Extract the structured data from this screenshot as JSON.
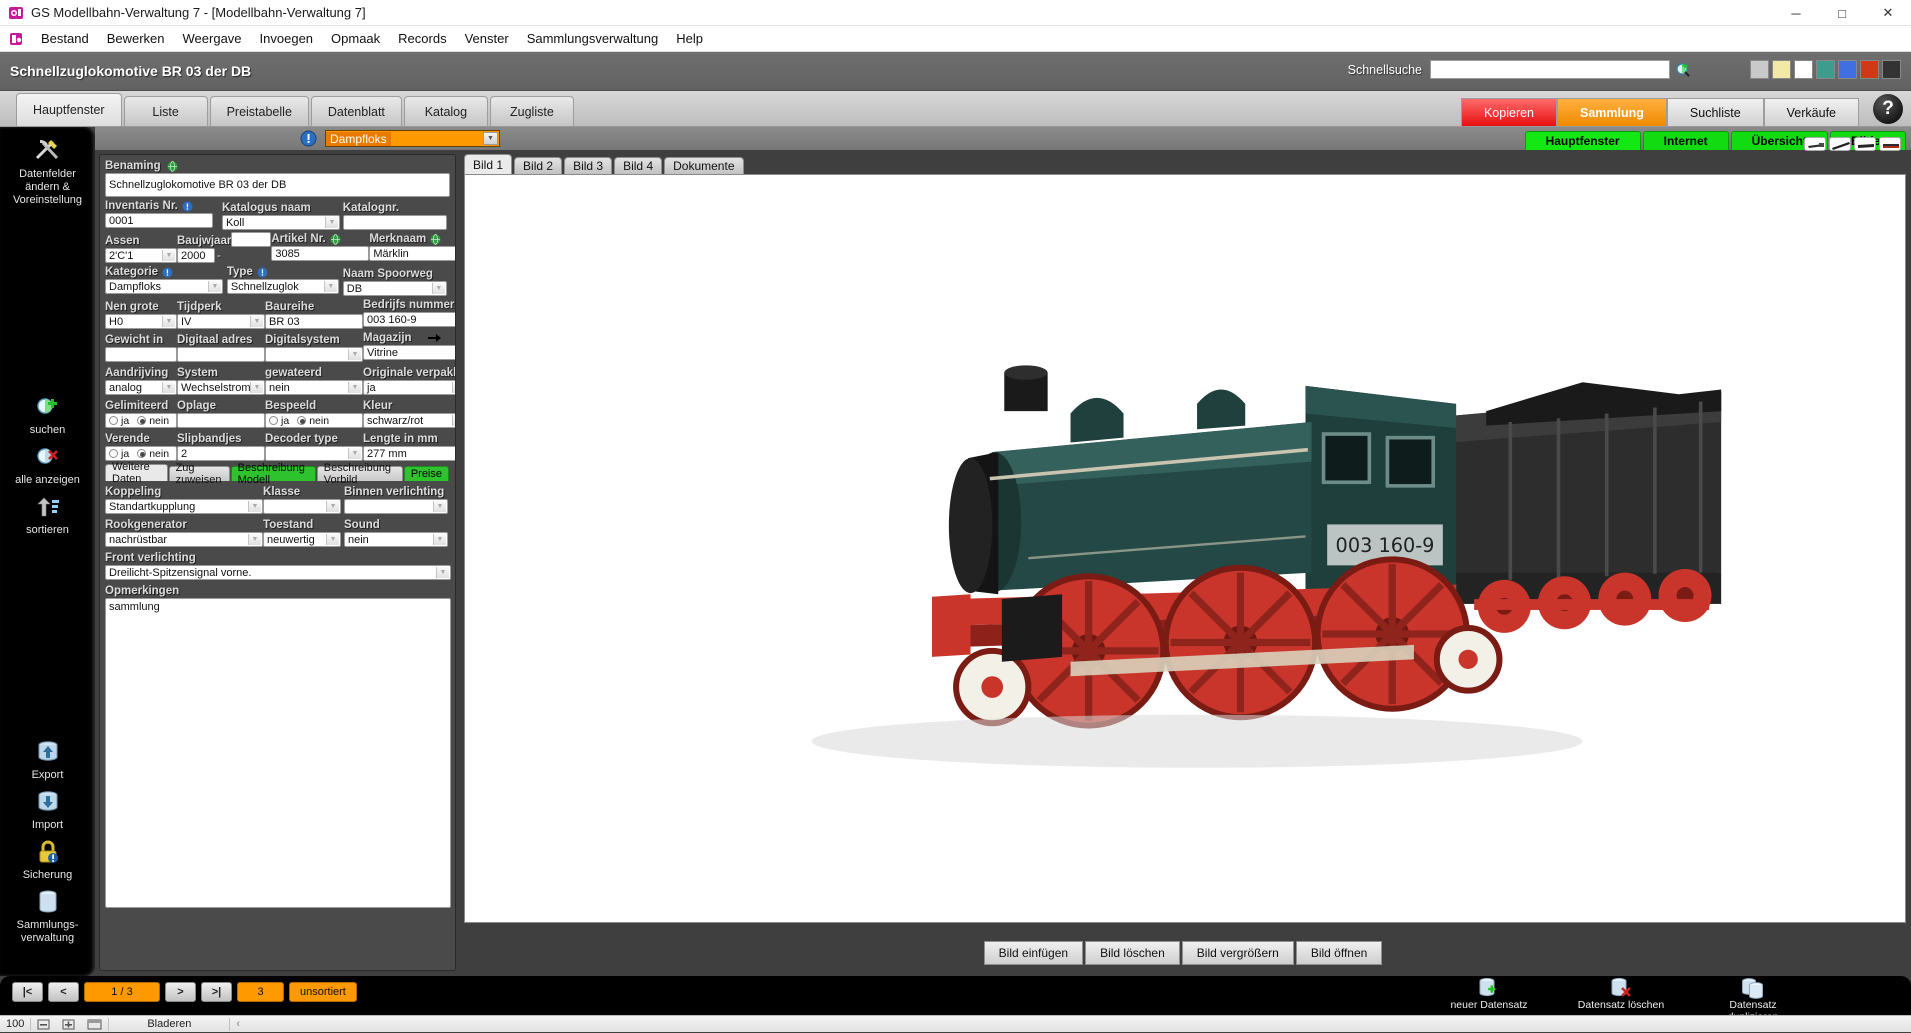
{
  "window": {
    "title": "GS Modellbahn-Verwaltung 7 - [Modellbahn-Verwaltung 7]",
    "minimize": "─",
    "maximize": "□",
    "close": "✕"
  },
  "menu": {
    "items": [
      "Bestand",
      "Bewerken",
      "Weergave",
      "Invoegen",
      "Opmaak",
      "Records",
      "Venster",
      "Sammlungsverwaltung",
      "Help"
    ]
  },
  "header": {
    "record_title": "Schnellzuglokomotive BR 03 der DB",
    "quick_search_label": "Schnellsuche",
    "quick_search_value": "",
    "swatch_colors": [
      "#c9c9c9",
      "#f2e9a8",
      "#ffffff",
      "#3f9b8c",
      "#3f6fe0",
      "#d03818",
      "#333333"
    ]
  },
  "main_tabs": [
    {
      "label": "Hauptfenster",
      "active": true
    },
    {
      "label": "Liste",
      "active": false
    },
    {
      "label": "Preistabelle",
      "active": false
    },
    {
      "label": "Datenblatt",
      "active": false
    },
    {
      "label": "Katalog",
      "active": false
    },
    {
      "label": "Zugliste",
      "active": false
    }
  ],
  "right_tabs": [
    {
      "label": "Kopieren",
      "style": "red"
    },
    {
      "label": "Sammlung",
      "style": "orange"
    },
    {
      "label": "Suchliste",
      "style": "plain"
    },
    {
      "label": "Verkäufe",
      "style": "plain"
    }
  ],
  "help_button": "?",
  "sidebar": {
    "top_item": {
      "label": "Datenfelder\nändern &\nVoreinstellung",
      "icon": "tools-icon"
    },
    "mid_items": [
      {
        "label": "suchen",
        "icon": "search-add-icon"
      },
      {
        "label": "alle anzeigen",
        "icon": "search-clear-icon"
      },
      {
        "label": "sortieren",
        "icon": "sort-icon"
      }
    ],
    "bottom_items": [
      {
        "label": "Export",
        "icon": "export-icon"
      },
      {
        "label": "Import",
        "icon": "import-icon"
      },
      {
        "label": "Sicherung",
        "icon": "lock-icon"
      },
      {
        "label": "Sammlungs-\nverwaltung",
        "icon": "database-icon"
      }
    ]
  },
  "category_bar": {
    "selected": "Dampfloks",
    "info_icon": "info-icon"
  },
  "panel_tabs": [
    {
      "label": "Hauptfenster",
      "active": true
    },
    {
      "label": "Internet",
      "active": false
    },
    {
      "label": "Übersicht",
      "active": false
    },
    {
      "label": "Bilder",
      "active": false
    }
  ],
  "form": {
    "benaming": {
      "label": "Benaming",
      "value": "Schnellzuglokomotive BR 03 der DB"
    },
    "row1": [
      {
        "label": "Inventaris Nr.",
        "value": "0001",
        "type": "text",
        "badge": "info"
      },
      {
        "label": "Katalogus naam",
        "value": "Koll",
        "type": "combo"
      },
      {
        "label": "Katalognr.",
        "value": "",
        "type": "text"
      }
    ],
    "row2": [
      {
        "label": "Assen",
        "value": "2'C'1",
        "type": "combo"
      },
      {
        "label": "Baujwjaar",
        "value": "2000",
        "type": "text"
      },
      {
        "label": "",
        "value": "",
        "type": "text"
      },
      {
        "label": "Artikel Nr.",
        "value": "3085",
        "type": "text",
        "badge": "globe"
      },
      {
        "label": "Merknaam",
        "value": "Märklin",
        "type": "combo",
        "badge": "globe"
      }
    ],
    "row3": [
      {
        "label": "Kategorie",
        "value": "Dampfloks",
        "type": "combo",
        "badge": "info"
      },
      {
        "label": "Type",
        "value": "Schnellzuglok",
        "type": "combo",
        "badge": "info"
      },
      {
        "label": "Naam Spoorweg",
        "value": "DB",
        "type": "combo"
      }
    ],
    "row4": [
      {
        "label": "Nen grote",
        "value": "H0",
        "type": "combo"
      },
      {
        "label": "Tijdperk",
        "value": "IV",
        "type": "combo"
      },
      {
        "label": "Baureihe",
        "value": "BR 03",
        "type": "text"
      },
      {
        "label": "Bedrijfs nummer",
        "value": "003 160-9",
        "type": "text",
        "badge": "arrow"
      }
    ],
    "row5": [
      {
        "label": "Gewicht in",
        "value": "",
        "type": "text"
      },
      {
        "label": "Digitaal adres",
        "value": "",
        "type": "text"
      },
      {
        "label": "Digitalsystem",
        "value": "",
        "type": "combo"
      },
      {
        "label": "Magazijn",
        "value": "Vitrine",
        "type": "text",
        "badge": "arrow"
      }
    ],
    "row6": [
      {
        "label": "Aandrijving",
        "value": "analog",
        "type": "combo"
      },
      {
        "label": "System",
        "value": "Wechselstrom",
        "type": "combo"
      },
      {
        "label": "gewateerd",
        "value": "nein",
        "type": "combo"
      },
      {
        "label": "Originale verpakking",
        "value": "ja",
        "type": "combo"
      }
    ],
    "row7": [
      {
        "label": "Gelimiteerd",
        "value": "nein",
        "type": "radio",
        "options": [
          "ja",
          "nein"
        ]
      },
      {
        "label": "Oplage",
        "value": "",
        "type": "text"
      },
      {
        "label": "Bespeeld",
        "value": "nein",
        "type": "radio",
        "options": [
          "ja",
          "nein"
        ]
      },
      {
        "label": "Kleur",
        "value": "schwarz/rot",
        "type": "combo"
      }
    ],
    "row8": [
      {
        "label": "Verende",
        "value": "nein",
        "type": "radio",
        "options": [
          "ja",
          "nein"
        ]
      },
      {
        "label": "Slipbandjes",
        "value": "2",
        "type": "text"
      },
      {
        "label": "Decoder type",
        "value": "",
        "type": "combo"
      },
      {
        "label": "Lengte in mm",
        "value": "277 mm",
        "type": "text"
      }
    ],
    "inner_tabs": [
      {
        "label": "Weitere Daten",
        "state": "active"
      },
      {
        "label": "Zug zuweisen",
        "state": "plain"
      },
      {
        "label": "Beschreibung Modell",
        "state": "green"
      },
      {
        "label": "Beschreibung Vorbild",
        "state": "plain"
      },
      {
        "label": "Preise",
        "state": "green"
      }
    ],
    "row9": [
      {
        "label": "Koppeling",
        "value": "Standartkupplung",
        "type": "combo"
      },
      {
        "label": "Klasse",
        "value": "",
        "type": "combo"
      },
      {
        "label": "Binnen verlichting",
        "value": "",
        "type": "combo"
      }
    ],
    "row10": [
      {
        "label": "Rookgenerator",
        "value": "nachrüstbar",
        "type": "combo"
      },
      {
        "label": "Toestand",
        "value": "neuwertig",
        "type": "combo"
      },
      {
        "label": "Sound",
        "value": "nein",
        "type": "combo"
      }
    ],
    "front_verlichting": {
      "label": "Front verlichting",
      "value": "Dreilicht-Spitzensignal vorne."
    },
    "opmerkingen": {
      "label": "Opmerkingen",
      "value": "sammlung"
    }
  },
  "image_panel": {
    "tabs": [
      {
        "label": "Bild 1",
        "active": true
      },
      {
        "label": "Bild 2",
        "active": false
      },
      {
        "label": "Bild 3",
        "active": false
      },
      {
        "label": "Bild 4",
        "active": false
      },
      {
        "label": "Dokumente",
        "active": false
      }
    ],
    "buttons": [
      "Bild einfügen",
      "Bild löschen",
      "Bild vergrößern",
      "Bild öffnen"
    ],
    "image_alt": "Märklin steam locomotive BR 03 model, green boiler with red wheels and black tender"
  },
  "bottom_nav": {
    "first": "|<",
    "prev": "<",
    "counter": "1   /   3",
    "next": ">",
    "last": ">|",
    "total": "3",
    "sort_state": "unsortiert"
  },
  "record_buttons": [
    {
      "label": "neuer Datensatz",
      "icon": "db-add-icon"
    },
    {
      "label": "Datensatz löschen",
      "icon": "db-delete-icon"
    },
    {
      "label": "Datensatz duplizieren",
      "icon": "db-duplicate-icon"
    }
  ],
  "status_bar": {
    "zoom": "100",
    "mode": "Bladeren"
  }
}
